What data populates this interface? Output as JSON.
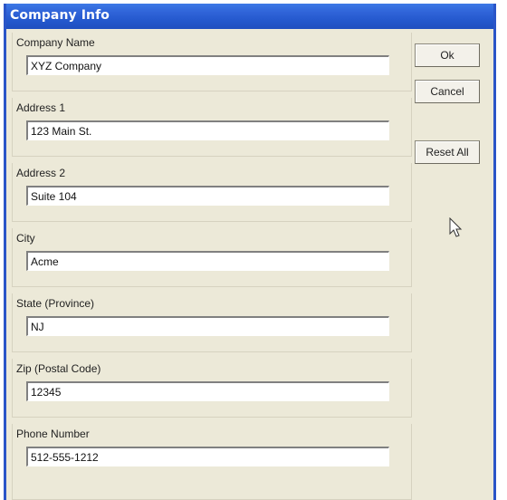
{
  "window": {
    "title": "Company Info"
  },
  "fields": [
    {
      "label": "Company Name",
      "value": "XYZ Company"
    },
    {
      "label": "Address 1",
      "value": "123 Main St."
    },
    {
      "label": "Address 2",
      "value": "Suite 104"
    },
    {
      "label": "City",
      "value": "Acme"
    },
    {
      "label": "State (Province)",
      "value": "NJ"
    },
    {
      "label": "Zip (Postal Code)",
      "value": "12345"
    },
    {
      "label": "Phone Number",
      "value": "512-555-1212"
    }
  ],
  "buttons": {
    "ok": "Ok",
    "cancel": "Cancel",
    "reset_all": "Reset All"
  },
  "colors": {
    "titlebar": "#2357cc",
    "dialog_background": "#ece9d8"
  },
  "icons": {
    "pointer": "mouse-pointer-icon"
  }
}
